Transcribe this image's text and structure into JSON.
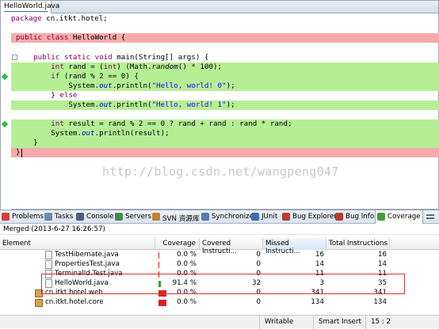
{
  "editor": {
    "tab_label": "HelloWorld.java",
    "lines": [
      {
        "text": "package cn.itkt.hotel;"
      },
      {
        "text": ""
      },
      {
        "text": "public class HelloWorld {"
      },
      {
        "text": ""
      },
      {
        "text": "    public static void main(String[] args) {"
      },
      {
        "text": "        int rand = (int) (Math.random() * 100);"
      },
      {
        "text": "        if (rand % 2 == 0) {"
      },
      {
        "text": "            System.out.println(\"Hello, world! 0\");"
      },
      {
        "text": "        } else"
      },
      {
        "text": "            System.out.println(\"Hello, world! 1\");"
      },
      {
        "text": ""
      },
      {
        "text": "        int result = rand % 2 == 0 ? rand + rand : rand * rand;"
      },
      {
        "text": "        System.out.println(result);"
      },
      {
        "text": "    }"
      },
      {
        "text": "}"
      }
    ],
    "watermark": "http://blog.csdn.net/wangpeng047"
  },
  "views": {
    "tabs": [
      {
        "label": "Problems",
        "icon": "problems-icon",
        "color": "#d04040"
      },
      {
        "label": "Tasks",
        "icon": "tasks-icon",
        "color": "#6a8ab8"
      },
      {
        "label": "Console",
        "icon": "console-icon",
        "color": "#50607a"
      },
      {
        "label": "Servers",
        "icon": "servers-icon",
        "color": "#4a8a4a"
      },
      {
        "label": "SVN 资源库",
        "icon": "svn-icon",
        "color": "#c08030"
      },
      {
        "label": "Synchronize",
        "icon": "synchronize-icon",
        "color": "#5a7ab0"
      },
      {
        "label": "JUnit",
        "icon": "junit-icon",
        "color": "#3a70b0"
      },
      {
        "label": "Bug Explorer",
        "icon": "bug-explorer-icon",
        "color": "#b04030"
      },
      {
        "label": "Bug Info",
        "icon": "bug-info-icon",
        "color": "#b04030"
      },
      {
        "label": "Coverage",
        "icon": "coverage-icon",
        "color": "#40a040"
      }
    ],
    "merged_label": "Merged (2013-6-27 16:26:57)"
  },
  "coverage": {
    "columns": [
      "Element",
      "Coverage",
      "Covered Instructi...",
      "Missed Instructi...",
      "Total Instructions"
    ],
    "rows": [
      {
        "element": "TestHibernate.java",
        "coverage": "0.0 %",
        "covered": "0",
        "missed": "16",
        "total": "16",
        "kind": "file",
        "fraction": 0.0
      },
      {
        "element": "PropertiesTest.java",
        "coverage": "0.0 %",
        "covered": "0",
        "missed": "14",
        "total": "14",
        "kind": "file",
        "fraction": 0.0
      },
      {
        "element": "TerminalId.Test.java",
        "coverage": "0.0 %",
        "covered": "0",
        "missed": "11",
        "total": "11",
        "kind": "file",
        "fraction": 0.0
      },
      {
        "element": "HelloWorld.java",
        "coverage": "91.4 %",
        "covered": "32",
        "missed": "3",
        "total": "35",
        "kind": "file",
        "fraction": 0.914
      },
      {
        "element": "cn.itkt.hotel.web",
        "coverage": "0.0 %",
        "covered": "0",
        "missed": "341",
        "total": "341",
        "kind": "package",
        "fraction": 0.0
      },
      {
        "element": "cn.itkt.hotel.core",
        "coverage": "0.0 %",
        "covered": "0",
        "missed": "134",
        "total": "134",
        "kind": "package",
        "fraction": 0.0
      }
    ]
  },
  "status": {
    "mode": "Writable",
    "insert": "Smart Insert",
    "position": "15 : 2"
  },
  "colors": {
    "uncovered": "#f7aaaa",
    "covered": "#b5ef95",
    "bar_red": "#e02020",
    "bar_green": "#20b020"
  }
}
